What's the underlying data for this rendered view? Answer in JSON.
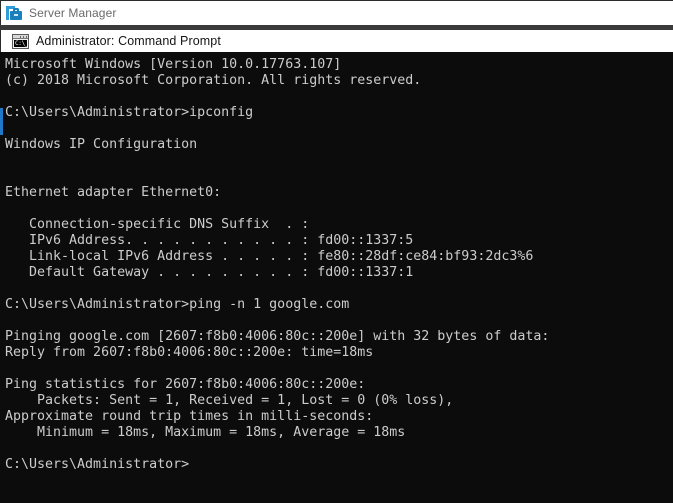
{
  "window": {
    "server_manager": {
      "title": "Server Manager",
      "icon": "server-manager-icon"
    },
    "command_prompt": {
      "title": "Administrator: Command Prompt",
      "icon": "command-prompt-icon",
      "icon_glyph": "C:\\_"
    }
  },
  "console": {
    "background_color": "#0c0c0c",
    "text_color": "#cccccc",
    "cursor_color": "#1f78c8",
    "lines": [
      "Microsoft Windows [Version 10.0.17763.107]",
      "(c) 2018 Microsoft Corporation. All rights reserved.",
      "",
      "C:\\Users\\Administrator>ipconfig",
      "",
      "Windows IP Configuration",
      "",
      "",
      "Ethernet adapter Ethernet0:",
      "",
      "   Connection-specific DNS Suffix  . :",
      "   IPv6 Address. . . . . . . . . . . : fd00::1337:5",
      "   Link-local IPv6 Address . . . . . : fe80::28df:ce84:bf93:2dc3%6",
      "   Default Gateway . . . . . . . . . : fd00::1337:1",
      "",
      "C:\\Users\\Administrator>ping -n 1 google.com",
      "",
      "Pinging google.com [2607:f8b0:4006:80c::200e] with 32 bytes of data:",
      "Reply from 2607:f8b0:4006:80c::200e: time=18ms",
      "",
      "Ping statistics for 2607:f8b0:4006:80c::200e:",
      "    Packets: Sent = 1, Received = 1, Lost = 0 (0% loss),",
      "Approximate round trip times in milli-seconds:",
      "    Minimum = 18ms, Maximum = 18ms, Average = 18ms",
      "",
      "C:\\Users\\Administrator>"
    ],
    "details": {
      "os_version": "10.0.17763.107",
      "copyright_year": "2018",
      "prompt_path": "C:\\Users\\Administrator>",
      "commands": [
        "ipconfig",
        "ping -n 1 google.com"
      ],
      "adapter_name": "Ethernet0",
      "dns_suffix": "",
      "ipv6_address": "fd00::1337:5",
      "link_local_ipv6": "fe80::28df:ce84:bf93:2dc3%6",
      "default_gateway": "fd00::1337:1",
      "ping_host": "google.com",
      "ping_resolved_ip": "2607:f8b0:4006:80c::200e",
      "ping_bytes": "32",
      "ping_time": "18ms",
      "packets_sent": "1",
      "packets_received": "1",
      "packets_lost": "0",
      "loss_percent": "0%",
      "rtt_minimum": "18ms",
      "rtt_maximum": "18ms",
      "rtt_average": "18ms"
    }
  }
}
